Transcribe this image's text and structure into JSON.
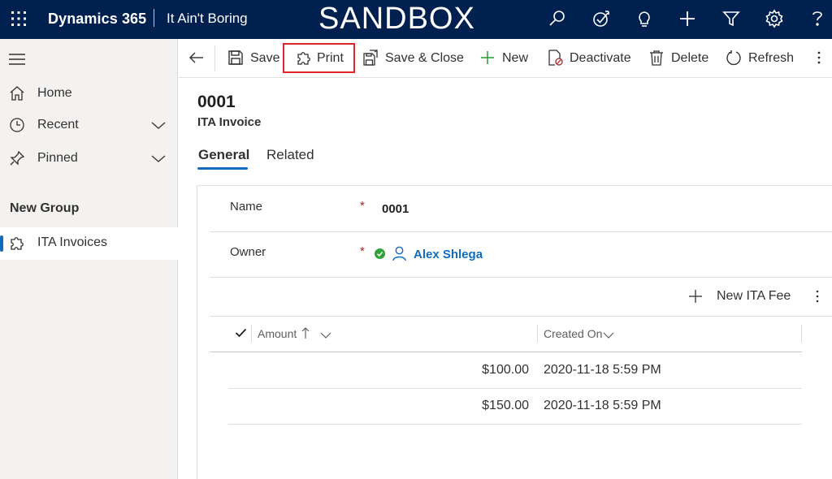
{
  "topbar": {
    "brand": "Dynamics 365",
    "app_name": "It Ain't Boring",
    "environment_label": "SANDBOX",
    "icons": [
      "waffle-icon",
      "search-icon",
      "task-icon",
      "lightbulb-icon",
      "plus-icon",
      "filter-icon",
      "gear-icon",
      "help-icon"
    ]
  },
  "sidebar": {
    "items": [
      {
        "label": "Home",
        "icon": "home-icon"
      },
      {
        "label": "Recent",
        "icon": "clock-icon"
      },
      {
        "label": "Pinned",
        "icon": "pin-icon"
      }
    ],
    "group_label": "New Group",
    "entity_item": {
      "label": "ITA Invoices",
      "icon": "puzzle-icon"
    }
  },
  "commandbar": {
    "save": "Save",
    "print": "Print",
    "save_close": "Save & Close",
    "new": "New",
    "deactivate": "Deactivate",
    "delete": "Delete",
    "refresh": "Refresh"
  },
  "record": {
    "title": "0001",
    "entity": "ITA Invoice",
    "tabs": [
      "General",
      "Related"
    ]
  },
  "form": {
    "name_label": "Name",
    "name_value": "0001",
    "owner_label": "Owner",
    "owner_value": "Alex Shlega",
    "required_marker": "*"
  },
  "subgrid": {
    "new_button": "New ITA Fee",
    "columns": [
      "Amount",
      "Created On"
    ],
    "rows": [
      {
        "amount": "$100.00",
        "created_on": "2020-11-18 5:59 PM"
      },
      {
        "amount": "$150.00",
        "created_on": "2020-11-18 5:59 PM"
      }
    ]
  },
  "colors": {
    "topbar": "#002050",
    "accent": "#0f6cbd",
    "highlight": "#e0242b",
    "required": "#a4262c",
    "status_ok": "#2fa33a"
  }
}
